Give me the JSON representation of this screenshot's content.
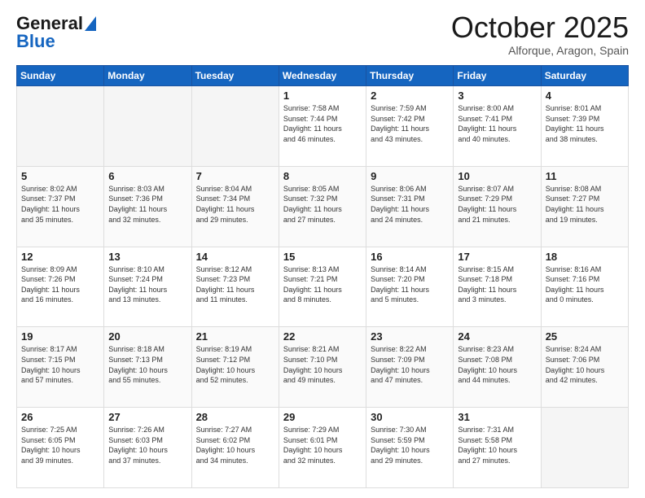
{
  "logo": {
    "line1": "General",
    "line2": "Blue"
  },
  "title": "October 2025",
  "subtitle": "Alforque, Aragon, Spain",
  "days_of_week": [
    "Sunday",
    "Monday",
    "Tuesday",
    "Wednesday",
    "Thursday",
    "Friday",
    "Saturday"
  ],
  "weeks": [
    [
      {
        "day": "",
        "info": ""
      },
      {
        "day": "",
        "info": ""
      },
      {
        "day": "",
        "info": ""
      },
      {
        "day": "1",
        "info": "Sunrise: 7:58 AM\nSunset: 7:44 PM\nDaylight: 11 hours\nand 46 minutes."
      },
      {
        "day": "2",
        "info": "Sunrise: 7:59 AM\nSunset: 7:42 PM\nDaylight: 11 hours\nand 43 minutes."
      },
      {
        "day": "3",
        "info": "Sunrise: 8:00 AM\nSunset: 7:41 PM\nDaylight: 11 hours\nand 40 minutes."
      },
      {
        "day": "4",
        "info": "Sunrise: 8:01 AM\nSunset: 7:39 PM\nDaylight: 11 hours\nand 38 minutes."
      }
    ],
    [
      {
        "day": "5",
        "info": "Sunrise: 8:02 AM\nSunset: 7:37 PM\nDaylight: 11 hours\nand 35 minutes."
      },
      {
        "day": "6",
        "info": "Sunrise: 8:03 AM\nSunset: 7:36 PM\nDaylight: 11 hours\nand 32 minutes."
      },
      {
        "day": "7",
        "info": "Sunrise: 8:04 AM\nSunset: 7:34 PM\nDaylight: 11 hours\nand 29 minutes."
      },
      {
        "day": "8",
        "info": "Sunrise: 8:05 AM\nSunset: 7:32 PM\nDaylight: 11 hours\nand 27 minutes."
      },
      {
        "day": "9",
        "info": "Sunrise: 8:06 AM\nSunset: 7:31 PM\nDaylight: 11 hours\nand 24 minutes."
      },
      {
        "day": "10",
        "info": "Sunrise: 8:07 AM\nSunset: 7:29 PM\nDaylight: 11 hours\nand 21 minutes."
      },
      {
        "day": "11",
        "info": "Sunrise: 8:08 AM\nSunset: 7:27 PM\nDaylight: 11 hours\nand 19 minutes."
      }
    ],
    [
      {
        "day": "12",
        "info": "Sunrise: 8:09 AM\nSunset: 7:26 PM\nDaylight: 11 hours\nand 16 minutes."
      },
      {
        "day": "13",
        "info": "Sunrise: 8:10 AM\nSunset: 7:24 PM\nDaylight: 11 hours\nand 13 minutes."
      },
      {
        "day": "14",
        "info": "Sunrise: 8:12 AM\nSunset: 7:23 PM\nDaylight: 11 hours\nand 11 minutes."
      },
      {
        "day": "15",
        "info": "Sunrise: 8:13 AM\nSunset: 7:21 PM\nDaylight: 11 hours\nand 8 minutes."
      },
      {
        "day": "16",
        "info": "Sunrise: 8:14 AM\nSunset: 7:20 PM\nDaylight: 11 hours\nand 5 minutes."
      },
      {
        "day": "17",
        "info": "Sunrise: 8:15 AM\nSunset: 7:18 PM\nDaylight: 11 hours\nand 3 minutes."
      },
      {
        "day": "18",
        "info": "Sunrise: 8:16 AM\nSunset: 7:16 PM\nDaylight: 11 hours\nand 0 minutes."
      }
    ],
    [
      {
        "day": "19",
        "info": "Sunrise: 8:17 AM\nSunset: 7:15 PM\nDaylight: 10 hours\nand 57 minutes."
      },
      {
        "day": "20",
        "info": "Sunrise: 8:18 AM\nSunset: 7:13 PM\nDaylight: 10 hours\nand 55 minutes."
      },
      {
        "day": "21",
        "info": "Sunrise: 8:19 AM\nSunset: 7:12 PM\nDaylight: 10 hours\nand 52 minutes."
      },
      {
        "day": "22",
        "info": "Sunrise: 8:21 AM\nSunset: 7:10 PM\nDaylight: 10 hours\nand 49 minutes."
      },
      {
        "day": "23",
        "info": "Sunrise: 8:22 AM\nSunset: 7:09 PM\nDaylight: 10 hours\nand 47 minutes."
      },
      {
        "day": "24",
        "info": "Sunrise: 8:23 AM\nSunset: 7:08 PM\nDaylight: 10 hours\nand 44 minutes."
      },
      {
        "day": "25",
        "info": "Sunrise: 8:24 AM\nSunset: 7:06 PM\nDaylight: 10 hours\nand 42 minutes."
      }
    ],
    [
      {
        "day": "26",
        "info": "Sunrise: 7:25 AM\nSunset: 6:05 PM\nDaylight: 10 hours\nand 39 minutes."
      },
      {
        "day": "27",
        "info": "Sunrise: 7:26 AM\nSunset: 6:03 PM\nDaylight: 10 hours\nand 37 minutes."
      },
      {
        "day": "28",
        "info": "Sunrise: 7:27 AM\nSunset: 6:02 PM\nDaylight: 10 hours\nand 34 minutes."
      },
      {
        "day": "29",
        "info": "Sunrise: 7:29 AM\nSunset: 6:01 PM\nDaylight: 10 hours\nand 32 minutes."
      },
      {
        "day": "30",
        "info": "Sunrise: 7:30 AM\nSunset: 5:59 PM\nDaylight: 10 hours\nand 29 minutes."
      },
      {
        "day": "31",
        "info": "Sunrise: 7:31 AM\nSunset: 5:58 PM\nDaylight: 10 hours\nand 27 minutes."
      },
      {
        "day": "",
        "info": ""
      }
    ]
  ]
}
